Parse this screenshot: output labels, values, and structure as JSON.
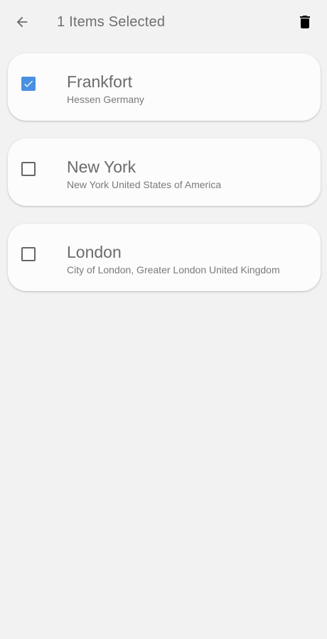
{
  "header": {
    "title": "1 Items Selected",
    "back_icon": "arrow-back-icon",
    "delete_icon": "trash-icon"
  },
  "colors": {
    "background": "#f2f2f2",
    "card": "#fcfcfc",
    "accent": "#4a90e2",
    "text": "#6b6b6b"
  },
  "items": [
    {
      "title": "Frankfort",
      "subtitle": "Hessen Germany",
      "checked": true
    },
    {
      "title": "New York",
      "subtitle": "New York United States of America",
      "checked": false
    },
    {
      "title": "London",
      "subtitle": "City of London, Greater London United Kingdom",
      "checked": false
    }
  ]
}
